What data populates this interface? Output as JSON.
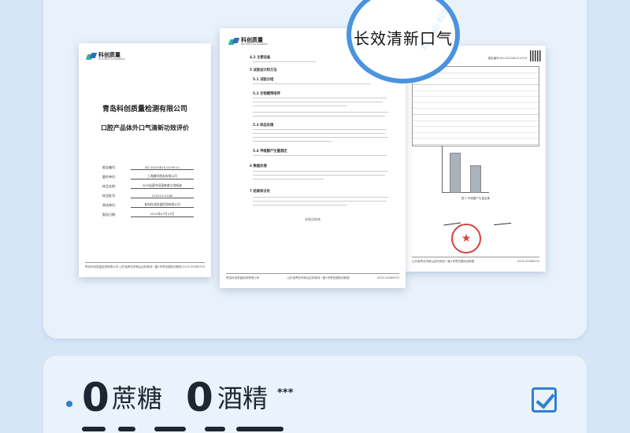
{
  "left_doc": {
    "company": "青岛科创质量检测有限公司",
    "subtitle": "口腔产品体外口气清新功效评价",
    "logo_text": "科创质量",
    "logo_sub": "Sci-tech Innovation",
    "rows": [
      {
        "key": "报告编号:",
        "value": "XD-2022061S-0159CL1"
      },
      {
        "key": "委托单位:",
        "value": "上海趣学朋友有限公司"
      },
      {
        "key": "样品名称:",
        "value": "BOP益菌专研菌爽漱口泡咽液"
      },
      {
        "key": "样品批号:",
        "value": "220415-5148I"
      },
      {
        "key": "测试单位:",
        "value": "青岛科创质量检测有限公司"
      },
      {
        "key": "报告日期:",
        "value": "2022年07月23日"
      }
    ],
    "footer_left": "青岛科创质量检测有限公司",
    "footer_mid": "山东省青岛市崂山区科苑纬一路1号青岛国际创新园",
    "footer_right": "0532-55585333"
  },
  "mid_doc": {
    "logo_text": "科创质量",
    "logo_sub": "Sci-tech Innovation",
    "sections": [
      {
        "title": "4.2 主要设备"
      },
      {
        "title": "5 试验设计和方法"
      },
      {
        "title": "5.1 试验分组"
      },
      {
        "title": "5.2 生物膜预培养"
      },
      {
        "title": "5.3 样品处理"
      },
      {
        "title": "5.4 甲硫醇产生量测定"
      },
      {
        "title": "6 数据处理"
      },
      {
        "title": "7 结果和讨论"
      }
    ],
    "end_note": "本报告结束",
    "footer_left": "青岛科创质量检测有限公司",
    "footer_mid": "山东省青岛市崂山区科苑纬一路1号青岛国际创新园",
    "footer_right": "0532-55585333"
  },
  "right_doc": {
    "report_no": "报告编号:XD-2022061S-0159",
    "caption1": "图 2 甲硫醇产生量结果",
    "footer_mid": "山东省青岛市崂山区科苑纬一路1号青岛国际创新园",
    "footer_right": "0532-55585333"
  },
  "magnifier": {
    "text": "长效清新口气",
    "watermark": "Kc Lab 科创质量"
  },
  "features": {
    "zero1": "0",
    "label1": "蔗糖",
    "zero2": "0",
    "label2": "酒精",
    "stars": "***"
  },
  "colors": {
    "accent": "#2e7fd6",
    "background": "#d6e6f7",
    "text": "#1f2533"
  }
}
